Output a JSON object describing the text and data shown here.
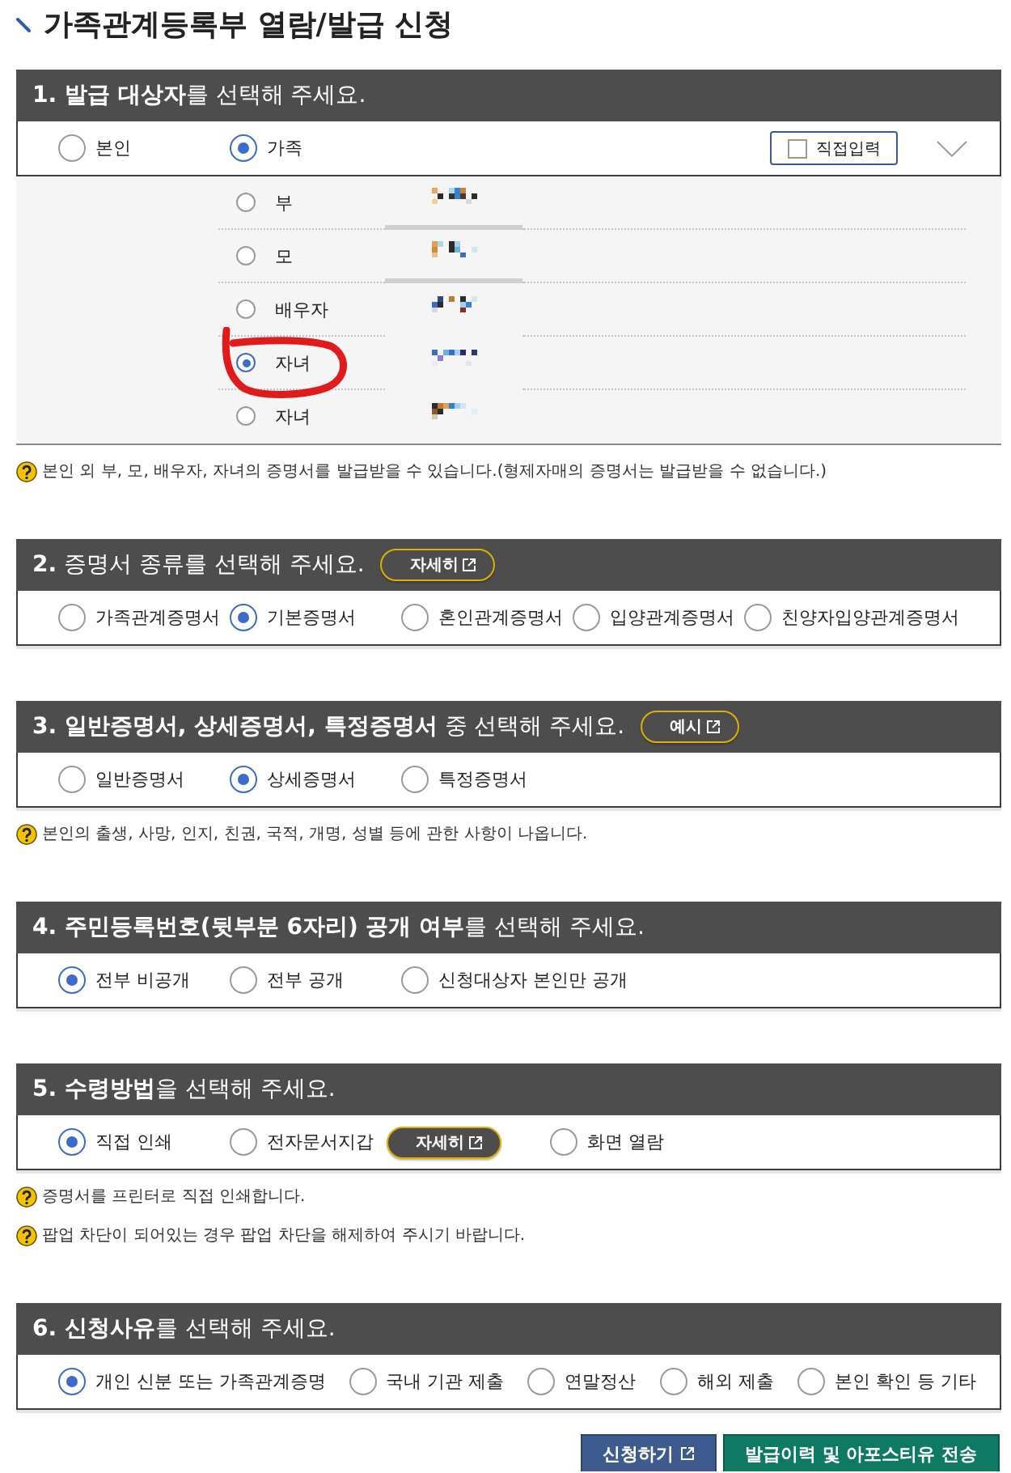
{
  "title": "가족관계등록부 열람/발급 신청",
  "sections": [
    {
      "heading": "**1. 발급 대상자**를 선택해 주세요.",
      "options": [
        {
          "label": "본인",
          "selected": false
        },
        {
          "label": "가족",
          "selected": true
        }
      ],
      "direct_input": {
        "label": "직접입력",
        "checked": false
      },
      "family": [
        {
          "relation": "부",
          "selected": false,
          "circled": false
        },
        {
          "relation": "모",
          "selected": false,
          "circled": false
        },
        {
          "relation": "배우자",
          "selected": false,
          "circled": false
        },
        {
          "relation": "자녀",
          "selected": true,
          "circled": true
        },
        {
          "relation": "자녀",
          "selected": false,
          "circled": false
        }
      ],
      "notes": [
        "본인 외 부, 모, 배우자, 자녀의 증명서를 발급받을 수 있습니다.(형제자매의 증명서는 발급받을 수 없습니다.)"
      ]
    },
    {
      "heading": "**2.** 증명서 종류를 선택해 주세요.",
      "link_button": "자세히",
      "options": [
        {
          "label": "가족관계증명서",
          "selected": false
        },
        {
          "label": "기본증명서",
          "selected": true
        },
        {
          "label": "혼인관계증명서",
          "selected": false
        },
        {
          "label": "입양관계증명서",
          "selected": false
        },
        {
          "label": "친양자입양관계증명서",
          "selected": false
        }
      ]
    },
    {
      "heading": "**3. 일반증명서, 상세증명서, 특정증명서** 중 선택해 주세요.",
      "link_button": "예시",
      "options": [
        {
          "label": "일반증명서",
          "selected": false
        },
        {
          "label": "상세증명서",
          "selected": true
        },
        {
          "label": "특정증명서",
          "selected": false
        }
      ],
      "notes": [
        "본인의 출생, 사망, 인지, 친권, 국적, 개명, 성별 등에 관한 사항이 나옵니다."
      ]
    },
    {
      "heading": "**4. 주민등록번호(뒷부분 6자리) 공개 여부**를 선택해 주세요.",
      "options": [
        {
          "label": "전부 비공개",
          "selected": true
        },
        {
          "label": "전부 공개",
          "selected": false
        },
        {
          "label": "신청대상자 본인만 공개",
          "selected": false
        }
      ]
    },
    {
      "heading": "**5. 수령방법**을 선택해 주세요.",
      "options": [
        {
          "label": "직접 인쇄",
          "selected": true
        },
        {
          "label": "전자문서지갑",
          "selected": false,
          "link_button": "자세히"
        },
        {
          "label": "화면 열람",
          "selected": false
        }
      ],
      "notes": [
        "증명서를 프린터로 직접 인쇄합니다.",
        "팝업 차단이 되어있는 경우 팝업 차단을 해제하여 주시기 바랍니다."
      ]
    },
    {
      "heading": "**6. 신청사유**를 선택해 주세요.",
      "options": [
        {
          "label": "개인 신분 또는 가족관계증명",
          "selected": true
        },
        {
          "label": "국내 기관 제출",
          "selected": false
        },
        {
          "label": "연말정산",
          "selected": false
        },
        {
          "label": "해외 제출",
          "selected": false
        },
        {
          "label": "본인 확인 등 기타",
          "selected": false
        }
      ]
    }
  ],
  "actions": [
    {
      "label": "신청하기",
      "kind": "primary",
      "external": true
    },
    {
      "label": "발급이력 및 아포스티유 전송",
      "kind": "secondary",
      "external": false
    }
  ]
}
